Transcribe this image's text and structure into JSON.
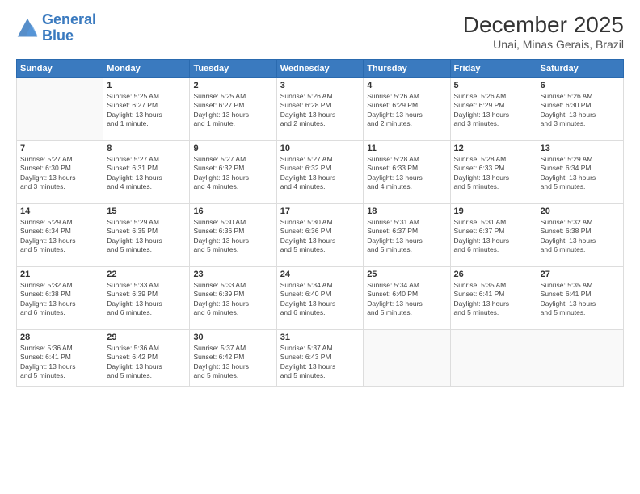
{
  "header": {
    "logo_line1": "General",
    "logo_line2": "Blue",
    "month_title": "December 2025",
    "subtitle": "Unai, Minas Gerais, Brazil"
  },
  "days_of_week": [
    "Sunday",
    "Monday",
    "Tuesday",
    "Wednesday",
    "Thursday",
    "Friday",
    "Saturday"
  ],
  "weeks": [
    [
      {
        "day": "",
        "info": ""
      },
      {
        "day": "1",
        "info": "Sunrise: 5:25 AM\nSunset: 6:27 PM\nDaylight: 13 hours\nand 1 minute."
      },
      {
        "day": "2",
        "info": "Sunrise: 5:25 AM\nSunset: 6:27 PM\nDaylight: 13 hours\nand 1 minute."
      },
      {
        "day": "3",
        "info": "Sunrise: 5:26 AM\nSunset: 6:28 PM\nDaylight: 13 hours\nand 2 minutes."
      },
      {
        "day": "4",
        "info": "Sunrise: 5:26 AM\nSunset: 6:29 PM\nDaylight: 13 hours\nand 2 minutes."
      },
      {
        "day": "5",
        "info": "Sunrise: 5:26 AM\nSunset: 6:29 PM\nDaylight: 13 hours\nand 3 minutes."
      },
      {
        "day": "6",
        "info": "Sunrise: 5:26 AM\nSunset: 6:30 PM\nDaylight: 13 hours\nand 3 minutes."
      }
    ],
    [
      {
        "day": "7",
        "info": "Sunrise: 5:27 AM\nSunset: 6:30 PM\nDaylight: 13 hours\nand 3 minutes."
      },
      {
        "day": "8",
        "info": "Sunrise: 5:27 AM\nSunset: 6:31 PM\nDaylight: 13 hours\nand 4 minutes."
      },
      {
        "day": "9",
        "info": "Sunrise: 5:27 AM\nSunset: 6:32 PM\nDaylight: 13 hours\nand 4 minutes."
      },
      {
        "day": "10",
        "info": "Sunrise: 5:27 AM\nSunset: 6:32 PM\nDaylight: 13 hours\nand 4 minutes."
      },
      {
        "day": "11",
        "info": "Sunrise: 5:28 AM\nSunset: 6:33 PM\nDaylight: 13 hours\nand 4 minutes."
      },
      {
        "day": "12",
        "info": "Sunrise: 5:28 AM\nSunset: 6:33 PM\nDaylight: 13 hours\nand 5 minutes."
      },
      {
        "day": "13",
        "info": "Sunrise: 5:29 AM\nSunset: 6:34 PM\nDaylight: 13 hours\nand 5 minutes."
      }
    ],
    [
      {
        "day": "14",
        "info": "Sunrise: 5:29 AM\nSunset: 6:34 PM\nDaylight: 13 hours\nand 5 minutes."
      },
      {
        "day": "15",
        "info": "Sunrise: 5:29 AM\nSunset: 6:35 PM\nDaylight: 13 hours\nand 5 minutes."
      },
      {
        "day": "16",
        "info": "Sunrise: 5:30 AM\nSunset: 6:36 PM\nDaylight: 13 hours\nand 5 minutes."
      },
      {
        "day": "17",
        "info": "Sunrise: 5:30 AM\nSunset: 6:36 PM\nDaylight: 13 hours\nand 5 minutes."
      },
      {
        "day": "18",
        "info": "Sunrise: 5:31 AM\nSunset: 6:37 PM\nDaylight: 13 hours\nand 5 minutes."
      },
      {
        "day": "19",
        "info": "Sunrise: 5:31 AM\nSunset: 6:37 PM\nDaylight: 13 hours\nand 6 minutes."
      },
      {
        "day": "20",
        "info": "Sunrise: 5:32 AM\nSunset: 6:38 PM\nDaylight: 13 hours\nand 6 minutes."
      }
    ],
    [
      {
        "day": "21",
        "info": "Sunrise: 5:32 AM\nSunset: 6:38 PM\nDaylight: 13 hours\nand 6 minutes."
      },
      {
        "day": "22",
        "info": "Sunrise: 5:33 AM\nSunset: 6:39 PM\nDaylight: 13 hours\nand 6 minutes."
      },
      {
        "day": "23",
        "info": "Sunrise: 5:33 AM\nSunset: 6:39 PM\nDaylight: 13 hours\nand 6 minutes."
      },
      {
        "day": "24",
        "info": "Sunrise: 5:34 AM\nSunset: 6:40 PM\nDaylight: 13 hours\nand 6 minutes."
      },
      {
        "day": "25",
        "info": "Sunrise: 5:34 AM\nSunset: 6:40 PM\nDaylight: 13 hours\nand 5 minutes."
      },
      {
        "day": "26",
        "info": "Sunrise: 5:35 AM\nSunset: 6:41 PM\nDaylight: 13 hours\nand 5 minutes."
      },
      {
        "day": "27",
        "info": "Sunrise: 5:35 AM\nSunset: 6:41 PM\nDaylight: 13 hours\nand 5 minutes."
      }
    ],
    [
      {
        "day": "28",
        "info": "Sunrise: 5:36 AM\nSunset: 6:41 PM\nDaylight: 13 hours\nand 5 minutes."
      },
      {
        "day": "29",
        "info": "Sunrise: 5:36 AM\nSunset: 6:42 PM\nDaylight: 13 hours\nand 5 minutes."
      },
      {
        "day": "30",
        "info": "Sunrise: 5:37 AM\nSunset: 6:42 PM\nDaylight: 13 hours\nand 5 minutes."
      },
      {
        "day": "31",
        "info": "Sunrise: 5:37 AM\nSunset: 6:43 PM\nDaylight: 13 hours\nand 5 minutes."
      },
      {
        "day": "",
        "info": ""
      },
      {
        "day": "",
        "info": ""
      },
      {
        "day": "",
        "info": ""
      }
    ]
  ]
}
